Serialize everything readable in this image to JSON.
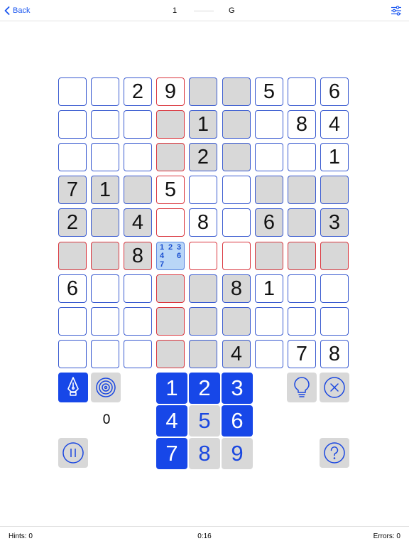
{
  "header": {
    "back_label": "Back",
    "level_number": "1",
    "level_letter": "G"
  },
  "board": {
    "rows": [
      [
        {
          "v": ""
        },
        {
          "v": ""
        },
        {
          "v": "2"
        },
        {
          "v": "9",
          "red": true
        },
        {
          "v": "",
          "gray": true
        },
        {
          "v": "",
          "gray": true
        },
        {
          "v": "5"
        },
        {
          "v": ""
        },
        {
          "v": "6"
        }
      ],
      [
        {
          "v": ""
        },
        {
          "v": ""
        },
        {
          "v": ""
        },
        {
          "v": "",
          "gray": true,
          "red": true
        },
        {
          "v": "1",
          "gray": true
        },
        {
          "v": "",
          "gray": true
        },
        {
          "v": ""
        },
        {
          "v": "8"
        },
        {
          "v": "4"
        }
      ],
      [
        {
          "v": ""
        },
        {
          "v": ""
        },
        {
          "v": ""
        },
        {
          "v": "",
          "gray": true,
          "red": true
        },
        {
          "v": "2",
          "gray": true
        },
        {
          "v": "",
          "gray": true
        },
        {
          "v": ""
        },
        {
          "v": ""
        },
        {
          "v": "1"
        }
      ],
      [
        {
          "v": "7",
          "gray": true
        },
        {
          "v": "1",
          "gray": true
        },
        {
          "v": "",
          "gray": true
        },
        {
          "v": "5",
          "red": true
        },
        {
          "v": ""
        },
        {
          "v": ""
        },
        {
          "v": "",
          "gray": true
        },
        {
          "v": "",
          "gray": true
        },
        {
          "v": "",
          "gray": true
        }
      ],
      [
        {
          "v": "2",
          "gray": true
        },
        {
          "v": "",
          "gray": true
        },
        {
          "v": "4",
          "gray": true
        },
        {
          "v": "",
          "red": true
        },
        {
          "v": "8"
        },
        {
          "v": ""
        },
        {
          "v": "6",
          "gray": true
        },
        {
          "v": "",
          "gray": true
        },
        {
          "v": "3",
          "gray": true
        }
      ],
      [
        {
          "v": "",
          "gray": true,
          "red": true
        },
        {
          "v": "",
          "gray": true,
          "red": true
        },
        {
          "v": "8",
          "gray": true,
          "red": true
        },
        {
          "v": "",
          "selected": true,
          "notes": [
            "1",
            "2",
            "3",
            "4",
            "",
            "6",
            "7",
            "",
            ""
          ]
        },
        {
          "v": "",
          "red": true
        },
        {
          "v": "",
          "red": true
        },
        {
          "v": "",
          "gray": true,
          "red": true
        },
        {
          "v": "",
          "gray": true,
          "red": true
        },
        {
          "v": "",
          "gray": true,
          "red": true
        }
      ],
      [
        {
          "v": "6"
        },
        {
          "v": ""
        },
        {
          "v": ""
        },
        {
          "v": "",
          "gray": true,
          "red": true
        },
        {
          "v": "",
          "gray": true
        },
        {
          "v": "8",
          "gray": true
        },
        {
          "v": "1"
        },
        {
          "v": ""
        },
        {
          "v": ""
        }
      ],
      [
        {
          "v": ""
        },
        {
          "v": ""
        },
        {
          "v": ""
        },
        {
          "v": "",
          "gray": true,
          "red": true
        },
        {
          "v": "",
          "gray": true
        },
        {
          "v": "",
          "gray": true
        },
        {
          "v": ""
        },
        {
          "v": ""
        },
        {
          "v": ""
        }
      ],
      [
        {
          "v": ""
        },
        {
          "v": ""
        },
        {
          "v": ""
        },
        {
          "v": "",
          "gray": true,
          "red": true
        },
        {
          "v": "",
          "gray": true
        },
        {
          "v": "4",
          "gray": true
        },
        {
          "v": ""
        },
        {
          "v": "7"
        },
        {
          "v": "8"
        }
      ]
    ]
  },
  "numpad": [
    {
      "label": "1",
      "style": "blue"
    },
    {
      "label": "2",
      "style": "blue"
    },
    {
      "label": "3",
      "style": "blue"
    },
    {
      "label": "4",
      "style": "blue"
    },
    {
      "label": "5",
      "style": "gray"
    },
    {
      "label": "6",
      "style": "blue"
    },
    {
      "label": "7",
      "style": "blue"
    },
    {
      "label": "8",
      "style": "gray"
    },
    {
      "label": "9",
      "style": "gray"
    }
  ],
  "tools": {
    "pen_icon": "pen-nib-icon",
    "target_icon": "target-icon",
    "hint_icon": "lightbulb-icon",
    "erase_icon": "close-circle-icon",
    "pause_icon": "pause-icon",
    "help_icon": "help-icon"
  },
  "score": "0",
  "status": {
    "hints": "Hints: 0",
    "timer": "0:16",
    "errors": "Errors: 0"
  },
  "colors": {
    "accent": "#1747e8",
    "cell_border": "#3a5bd0",
    "conflict_border": "#d9363e",
    "selected_fill": "#b9d6f7",
    "gray_fill": "#d8d8d8"
  }
}
